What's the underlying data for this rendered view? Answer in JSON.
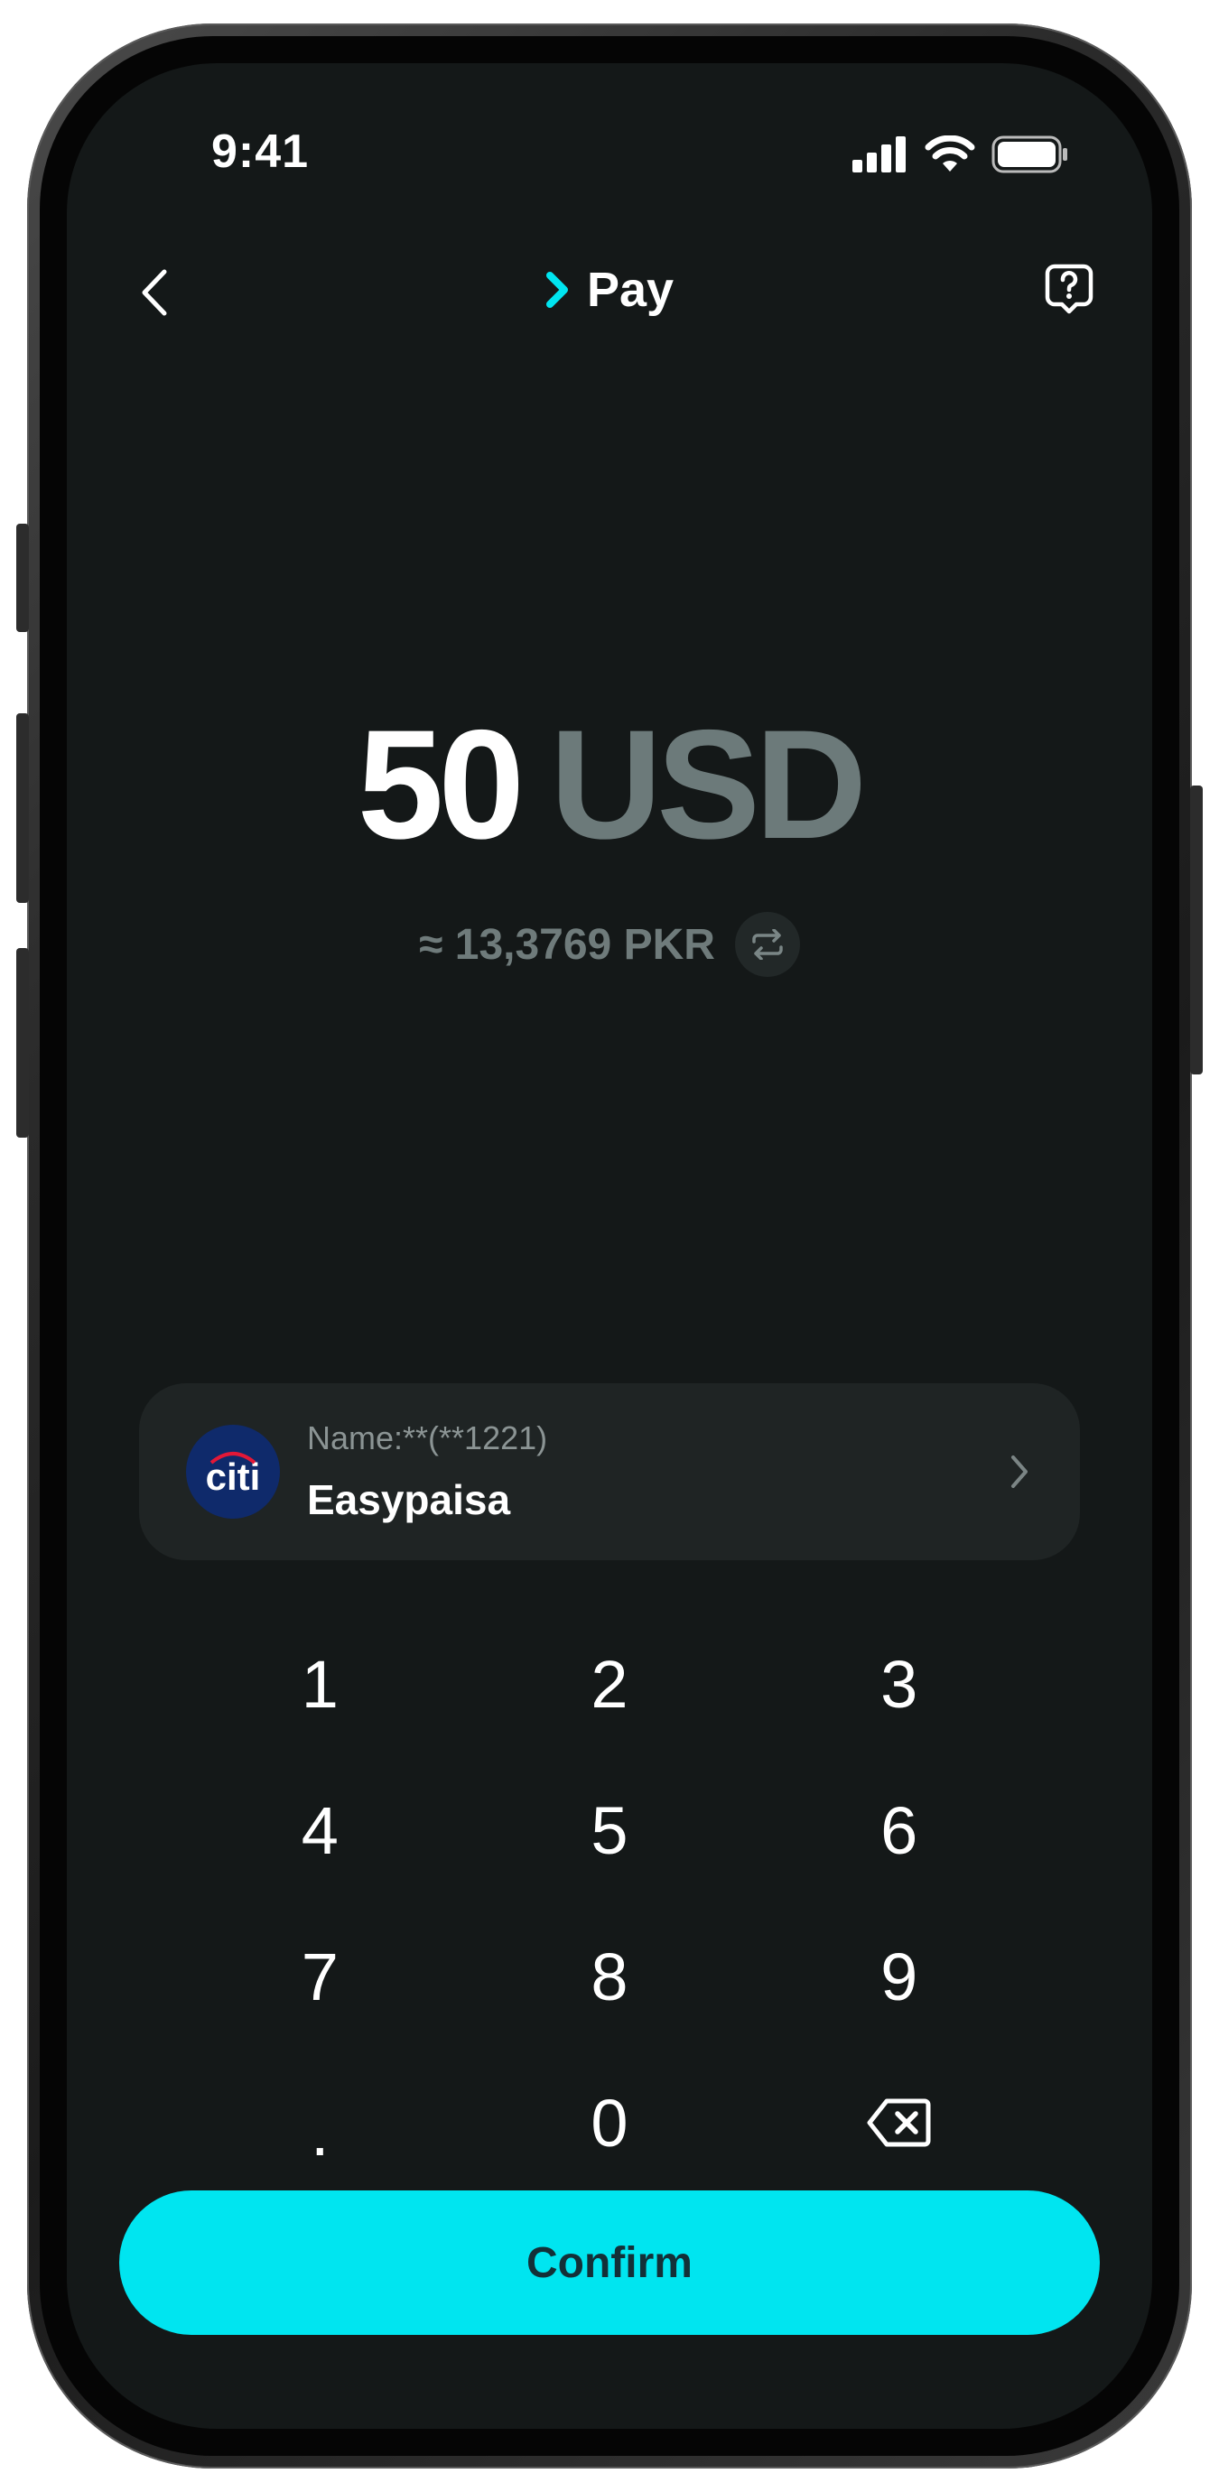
{
  "status_bar": {
    "time": "9:41"
  },
  "header": {
    "title": "Pay",
    "back_icon": "chevron-left-icon",
    "help_icon": "help-bubble-icon",
    "title_icon": "chevron-right-accent-icon"
  },
  "amount": {
    "value": "50",
    "currency": "USD",
    "conversion": "≈ 13,3769 PKR"
  },
  "account": {
    "logo_text": "citi",
    "name_label": "Name:**(**1221)",
    "bank_name": "Easypaisa"
  },
  "keypad": {
    "keys": [
      "1",
      "2",
      "3",
      "4",
      "5",
      "6",
      "7",
      "8",
      "9",
      ".",
      "0",
      "⌫"
    ]
  },
  "confirm": {
    "label": "Confirm"
  },
  "colors": {
    "accent": "#00e5f0",
    "background": "#141818",
    "card": "#1f2424",
    "muted": "#6c7a7a"
  }
}
